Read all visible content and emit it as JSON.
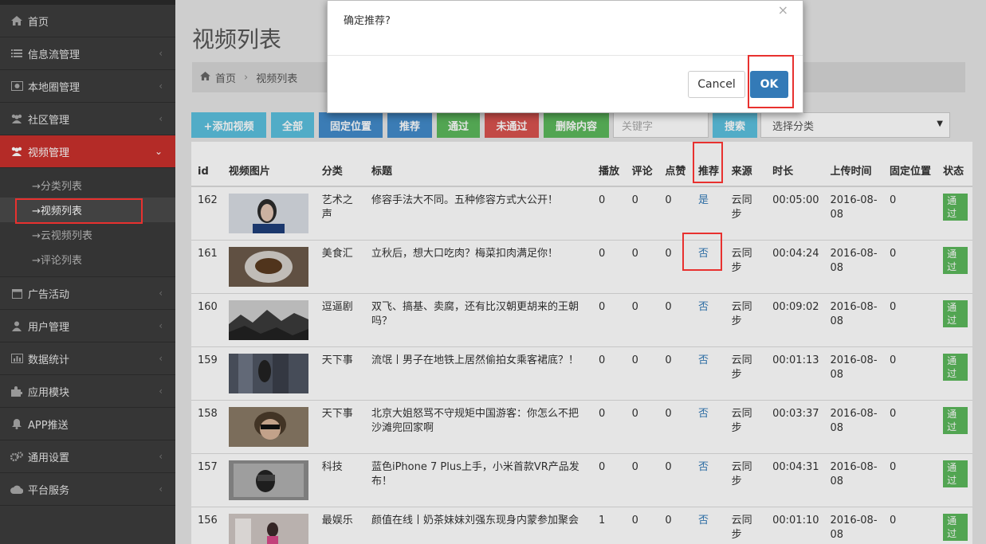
{
  "sidebar": {
    "items": [
      {
        "label": "首页",
        "icon": "home-icon"
      },
      {
        "label": "信息流管理",
        "icon": "list-icon"
      },
      {
        "label": "本地圈管理",
        "icon": "image-icon"
      },
      {
        "label": "社区管理",
        "icon": "users-icon"
      },
      {
        "label": "视频管理",
        "icon": "users-icon"
      },
      {
        "label": "广告活动",
        "icon": "calendar-icon"
      },
      {
        "label": "用户管理",
        "icon": "user-icon"
      },
      {
        "label": "数据统计",
        "icon": "chart-icon"
      },
      {
        "label": "应用模块",
        "icon": "puzzle-icon"
      },
      {
        "label": "APP推送",
        "icon": "bell-icon"
      },
      {
        "label": "通用设置",
        "icon": "gears-icon"
      },
      {
        "label": "平台服务",
        "icon": "cloud-icon"
      }
    ],
    "video_sub": [
      "→分类列表",
      "→视频列表",
      "→云视频列表",
      "→评论列表"
    ]
  },
  "page": {
    "title": "视频列表",
    "breadcrumb_home": "首页",
    "breadcrumb_sep": "›",
    "breadcrumb_current": "视频列表"
  },
  "toolbar": {
    "add": "+添加视频",
    "all": "全部",
    "fix": "固定位置",
    "recommend": "推荐",
    "pass": "通过",
    "nopass": "未通过",
    "delete": "删除内容",
    "keyword_placeholder": "关键字",
    "search": "搜索",
    "category_select": "选择分类"
  },
  "table": {
    "headers": [
      "id",
      "视频图片",
      "分类",
      "标题",
      "播放",
      "评论",
      "点赞",
      "推荐",
      "来源",
      "时长",
      "上传时间",
      "固定位置",
      "状态"
    ],
    "rows": [
      {
        "id": "162",
        "cat": "艺术之声",
        "title": "修容手法大不同。五种修容方式大公开！",
        "play": "0",
        "comment": "0",
        "like": "0",
        "rec": "是",
        "src": "云同步",
        "dur": "00:05:00",
        "time": "2016-08-08",
        "fixed": "0",
        "status": "通过"
      },
      {
        "id": "161",
        "cat": "美食汇",
        "title": "立秋后，想大口吃肉？梅菜扣肉满足你！",
        "play": "0",
        "comment": "0",
        "like": "0",
        "rec": "否",
        "src": "云同步",
        "dur": "00:04:24",
        "time": "2016-08-08",
        "fixed": "0",
        "status": "通过"
      },
      {
        "id": "160",
        "cat": "逗逼剧",
        "title": "双飞、搞基、卖腐，还有比汉朝更胡来的王朝吗？",
        "play": "0",
        "comment": "0",
        "like": "0",
        "rec": "否",
        "src": "云同步",
        "dur": "00:09:02",
        "time": "2016-08-08",
        "fixed": "0",
        "status": "通过"
      },
      {
        "id": "159",
        "cat": "天下事",
        "title": "流氓丨男子在地铁上居然偷拍女乘客裙底？！",
        "play": "0",
        "comment": "0",
        "like": "0",
        "rec": "否",
        "src": "云同步",
        "dur": "00:01:13",
        "time": "2016-08-08",
        "fixed": "0",
        "status": "通过"
      },
      {
        "id": "158",
        "cat": "天下事",
        "title": "北京大姐怒骂不守规矩中国游客：你怎么不把沙滩兜回家啊",
        "play": "0",
        "comment": "0",
        "like": "0",
        "rec": "否",
        "src": "云同步",
        "dur": "00:03:37",
        "time": "2016-08-08",
        "fixed": "0",
        "status": "通过"
      },
      {
        "id": "157",
        "cat": "科技",
        "title": "蓝色iPhone 7 Plus上手，小米首款VR产品发布！",
        "play": "0",
        "comment": "0",
        "like": "0",
        "rec": "否",
        "src": "云同步",
        "dur": "00:04:31",
        "time": "2016-08-08",
        "fixed": "0",
        "status": "通过"
      },
      {
        "id": "156",
        "cat": "最娱乐",
        "title": "颜值在线丨奶茶妹妹刘强东现身内蒙参加聚会",
        "play": "1",
        "comment": "0",
        "like": "0",
        "rec": "否",
        "src": "云同步",
        "dur": "00:01:10",
        "time": "2016-08-08",
        "fixed": "0",
        "status": "通过"
      }
    ]
  },
  "dialog": {
    "message": "确定推荐?",
    "close": "×",
    "cancel": "Cancel",
    "ok": "OK"
  },
  "colors": {
    "sidebar_bg": "#3d3d3d",
    "active_red": "#c9302c",
    "highlight_red": "#e8312f",
    "ok_blue": "#337ab7",
    "badge_green": "#5cb85c"
  }
}
